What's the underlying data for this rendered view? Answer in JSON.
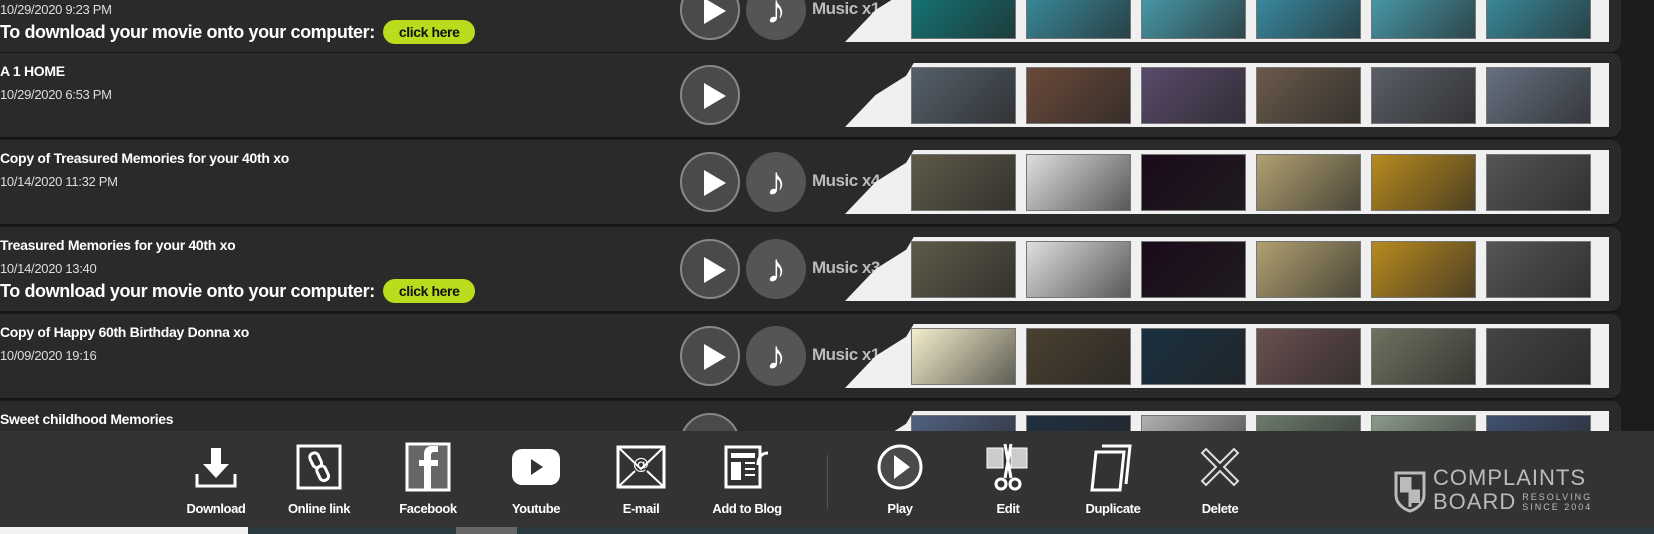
{
  "rows": [
    {
      "title": "",
      "date": "10/29/2020 9:23 PM",
      "download": true,
      "music": "Music x1",
      "thumbs": [
        "#147a7a",
        "#3a8fa0",
        "#4aa0b0",
        "#3a90a8",
        "#4aa0b0",
        "#3a8fa0"
      ]
    },
    {
      "title": "A 1 HOME",
      "date": "10/29/2020 6:53 PM",
      "download": false,
      "music": "",
      "thumbs": [
        "#55606a",
        "#6a4a3a",
        "#5a4a6a",
        "#6a5a4a",
        "#5a5e66",
        "#667080"
      ]
    },
    {
      "title": "Copy of Treasured Memories for your 40th xo",
      "date": "10/14/2020 11:32 PM",
      "download": false,
      "music": "Music x4",
      "thumbs": [
        "#5e5a48",
        "#dedede",
        "#1a0a1a",
        "#b0a070",
        "#b88a20",
        "#555"
      ]
    },
    {
      "title": "Treasured Memories for your 40th xo",
      "date": "10/14/2020 13:40",
      "download": true,
      "music": "Music x3",
      "thumbs": [
        "#5e5a48",
        "#dedede",
        "#1a0a1a",
        "#b0a070",
        "#b88a20",
        "#555"
      ]
    },
    {
      "title": "Copy of Happy 60th Birthday Donna xo",
      "date": "10/09/2020 19:16",
      "download": false,
      "music": "Music x1",
      "thumbs": [
        "#f4eecc",
        "#4a4030",
        "#1a3040",
        "#6a5050",
        "#707060",
        "#444"
      ]
    },
    {
      "title": "Sweet childhood Memories",
      "date": "",
      "download": false,
      "music": "",
      "thumbs": [
        "#506080",
        "#203040",
        "#b0b0b0",
        "#6a7a6a",
        "#8a9a8a",
        "#405070"
      ]
    }
  ],
  "download_text": "To download your movie onto your computer:",
  "click_label": "click here",
  "toolbar": [
    {
      "label": "Download",
      "icon": "download-icon"
    },
    {
      "label": "Online link",
      "icon": "link-icon"
    },
    {
      "label": "Facebook",
      "icon": "facebook-icon"
    },
    {
      "label": "Youtube",
      "icon": "youtube-icon"
    },
    {
      "label": "E-mail",
      "icon": "email-icon"
    },
    {
      "label": "Add to Blog",
      "icon": "blog-icon"
    },
    {
      "label": "Play",
      "icon": "play-icon"
    },
    {
      "label": "Edit",
      "icon": "edit-icon"
    },
    {
      "label": "Duplicate",
      "icon": "duplicate-icon"
    },
    {
      "label": "Delete",
      "icon": "delete-icon"
    }
  ],
  "logo": {
    "line1": "COMPLAINTS",
    "line2": "BOARD",
    "tag1": "RESOLVING",
    "tag2": "SINCE 2004"
  },
  "colors": {
    "accent": "#b9dc1c"
  }
}
